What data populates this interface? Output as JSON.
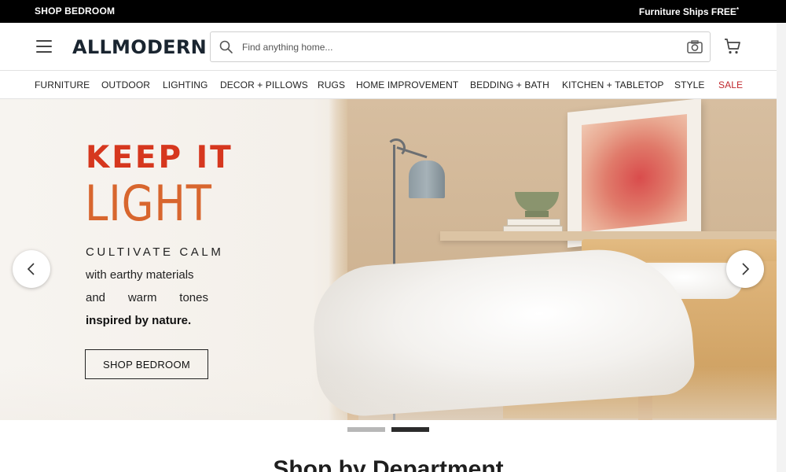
{
  "promo": {
    "left_text": "SHOP BEDROOM",
    "right_text": "Furniture Ships FREE",
    "right_sup": "*"
  },
  "header": {
    "logo": "ALLMODERN",
    "search_placeholder": "Find anything home...",
    "icons": [
      "menu-icon",
      "search-icon",
      "camera-icon",
      "cart-icon"
    ]
  },
  "nav": {
    "categories": [
      "FURNITURE",
      "OUTDOOR",
      "LIGHTING",
      "DECOR + PILLOWS",
      "RUGS",
      "HOME IMPROVEMENT",
      "BEDDING + BATH",
      "KITCHEN + TABLETOP",
      "STYLE",
      "SALE"
    ]
  },
  "hero": {
    "title_line1": "KEEP IT",
    "title_line2": "LIGHT",
    "subtitle": "CULTIVATE CALM",
    "line2": "with earthy materials",
    "line3": "and warm tones",
    "line4": "inspired by nature.",
    "cta": "SHOP BEDROOM",
    "slides_total": 2,
    "active_slide": 2
  },
  "section": {
    "heading": "Shop by Department"
  },
  "colors": {
    "promo_bg": "#000000",
    "title_red": "#d6371e",
    "title_orange": "#d8662e",
    "sale_red": "#c0272d",
    "dot_active": "#2b2b2b",
    "dot_inactive": "#b7b7b7"
  }
}
